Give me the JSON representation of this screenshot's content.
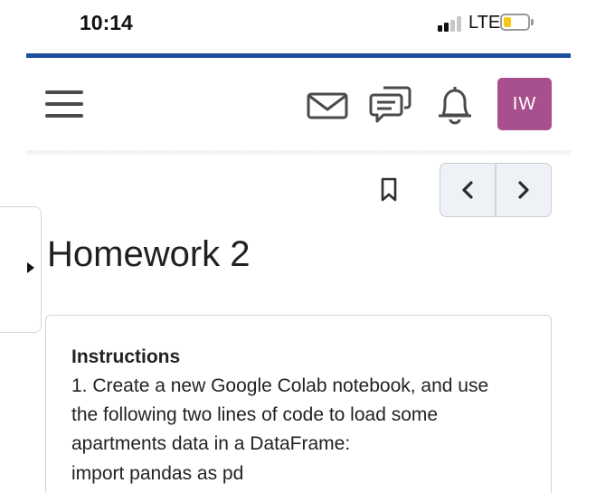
{
  "status_bar": {
    "time": "10:14",
    "carrier": "LTE",
    "signal_bars_active": 2,
    "signal_bars_total": 4,
    "battery_level": 0.3,
    "battery_color": "#f7c71a"
  },
  "colors": {
    "brand_bar": "#1d4f9e",
    "avatar_bg": "#a8508d",
    "icon": "#4a4a4a"
  },
  "nav": {
    "icons": [
      "menu-icon",
      "mail-icon",
      "chat-icon",
      "bell-icon"
    ],
    "avatar_initials": "IW"
  },
  "toolbar": {
    "bookmark_icon": "bookmark-icon",
    "prev_icon": "chevron-left-icon",
    "next_icon": "chevron-right-icon"
  },
  "page": {
    "title": "Homework 2"
  },
  "content": {
    "heading": "Instructions",
    "lines": [
      "1. Create a new Google Colab notebook, and use",
      "the following two lines of code to load some",
      "apartments data in a DataFrame:",
      "import pandas as pd"
    ]
  }
}
